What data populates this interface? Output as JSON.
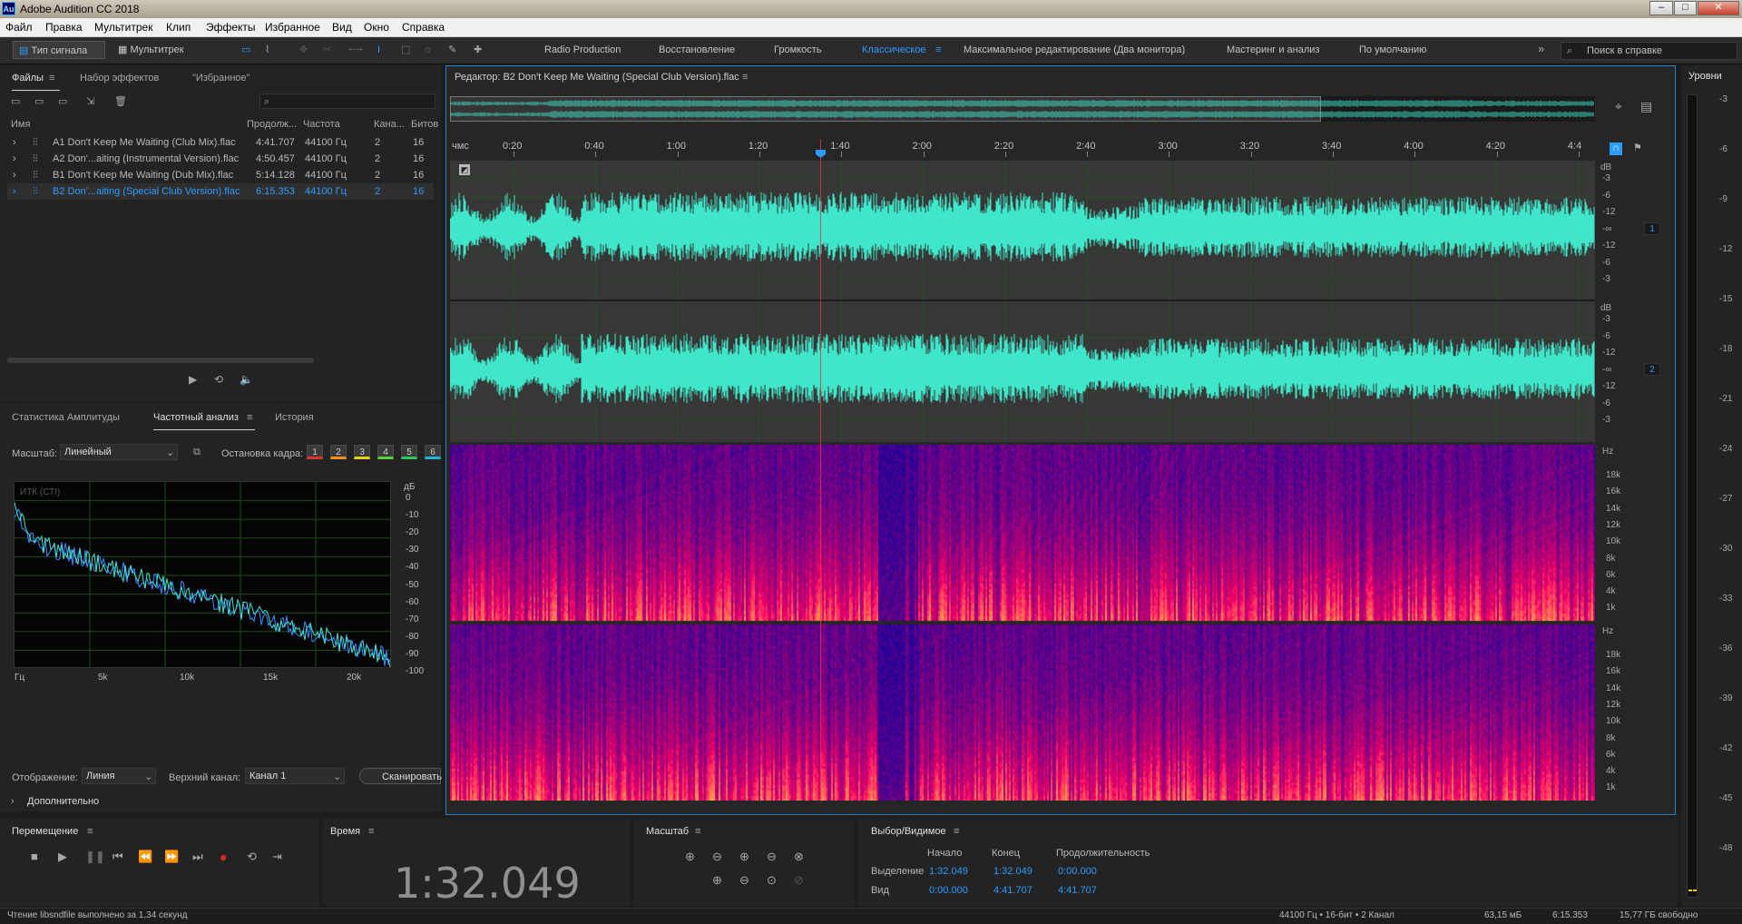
{
  "app": {
    "title": "Adobe Audition CC 2018",
    "icon": "Au"
  },
  "menu": [
    "Файл",
    "Правка",
    "Мультитрек",
    "Клип",
    "Эффекты",
    "Избранное",
    "Вид",
    "Окно",
    "Справка"
  ],
  "toolbar": {
    "mode_waveform": "Тип сигнала",
    "mode_multitrack": "Мультитрек",
    "workspaces": [
      "Radio Production",
      "Восстановление",
      "Громкость",
      "Классическое",
      "Максимальное редактирование (Два монитора)",
      "Мастеринг и анализ",
      "По умолчанию"
    ],
    "active_workspace": "Классическое",
    "search_placeholder": "Поиск в справке"
  },
  "files_panel": {
    "tabs": [
      "Файлы",
      "Набор эффектов",
      "\"Избранное\""
    ],
    "columns": [
      "Имя",
      "Продолж...",
      "Частота",
      "Кана...",
      "Битов"
    ],
    "rows": [
      {
        "name": "A1 Don't Keep Me Waiting (Club Mix).flac",
        "duration": "4:41.707",
        "rate": "44100 Гц",
        "channels": "2",
        "bits": "16"
      },
      {
        "name": "A2 Don'...aiting (Instrumental Version).flac",
        "duration": "4:50.457",
        "rate": "44100 Гц",
        "channels": "2",
        "bits": "16"
      },
      {
        "name": "B1 Don't Keep Me Waiting (Dub Mix).flac",
        "duration": "5:14.128",
        "rate": "44100 Гц",
        "channels": "2",
        "bits": "16"
      },
      {
        "name": "B2 Don'...aiting (Special Club Version).flac",
        "duration": "6:15.353",
        "rate": "44100 Гц",
        "channels": "2",
        "bits": "16"
      }
    ]
  },
  "freq_panel": {
    "tabs": [
      "Статистика Амплитуды",
      "Частотный анализ",
      "История"
    ],
    "scale_label": "Масштаб:",
    "scale_value": "Линейный",
    "freeze_label": "Остановка кадра:",
    "freeze_buttons": [
      "1",
      "2",
      "3",
      "4",
      "5",
      "6"
    ],
    "freeze_colors": [
      "#e03030",
      "#ff8c1a",
      "#e8d219",
      "#55d23c",
      "#2dc95a",
      "#1fb7d8"
    ],
    "plot_label": "ИТК (СТI)",
    "db_unit": "дБ",
    "db_ticks": [
      "0",
      "-10",
      "-20",
      "-30",
      "-40",
      "-50",
      "-60",
      "-70",
      "-80",
      "-90",
      "-100"
    ],
    "x_ticks": [
      "Гц",
      "5k",
      "10k",
      "15k",
      "20k"
    ],
    "display_label": "Отображение:",
    "display_value": "Линия",
    "channel_label": "Верхний канал:",
    "channel_value": "Канал 1",
    "scan_button": "Сканировать",
    "advanced": "Дополнительно"
  },
  "editor": {
    "title": "Редактор: B2 Don't Keep Me Waiting (Special Club Version).flac",
    "time_unit": "чмс",
    "time_ticks": [
      "0:20",
      "0:40",
      "1:00",
      "1:20",
      "1:40",
      "2:00",
      "2:20",
      "2:40",
      "3:00",
      "3:20",
      "3:40",
      "4:00",
      "4:20",
      "4:4"
    ],
    "db_label": "dB",
    "db_ticks": [
      "-3",
      "-6",
      "-12",
      "-∞",
      "-12",
      "-6",
      "-3"
    ],
    "ch1": "1",
    "ch2": "2",
    "hz_label": "Hz",
    "hz_ticks": [
      "18k",
      "16k",
      "14k",
      "12k",
      "10k",
      "8k",
      "6k",
      "4k",
      "1k"
    ]
  },
  "levels": {
    "title": "Уровни",
    "ticks": [
      "-3",
      "-6",
      "-9",
      "-12",
      "-15",
      "-18",
      "-21",
      "-24",
      "-27",
      "-30",
      "-33",
      "-36",
      "-39",
      "-42",
      "-45",
      "-48"
    ]
  },
  "transport": {
    "title": "Перемещение",
    "buttons": [
      "stop-icon",
      "play-icon",
      "pause-icon",
      "go-start-icon",
      "rewind-icon",
      "forward-icon",
      "go-end-icon",
      "record-icon",
      "loop-icon",
      "skip-icon"
    ]
  },
  "time_panel": {
    "title": "Время",
    "value": "1:32.049"
  },
  "zoom_panel": {
    "title": "Масштаб"
  },
  "selection": {
    "title": "Выбор/Видимое",
    "col_start": "Начало",
    "col_end": "Конец",
    "col_duration": "Продолжительность",
    "sel_label": "Выделение",
    "sel_start": "1:32.049",
    "sel_end": "1:32.049",
    "sel_duration": "0:00.000",
    "view_label": "Вид",
    "view_start": "0:00.000",
    "view_end": "4:41.707",
    "view_duration": "4:41.707"
  },
  "status": {
    "left": "Чтение libsndfile выполнено за 1,34 секунд",
    "format": "44100 Гц • 16-бит • 2 Канал",
    "size": "63,15 мБ",
    "duration": "6:15.353",
    "free": "15,77 ГБ свободно"
  }
}
